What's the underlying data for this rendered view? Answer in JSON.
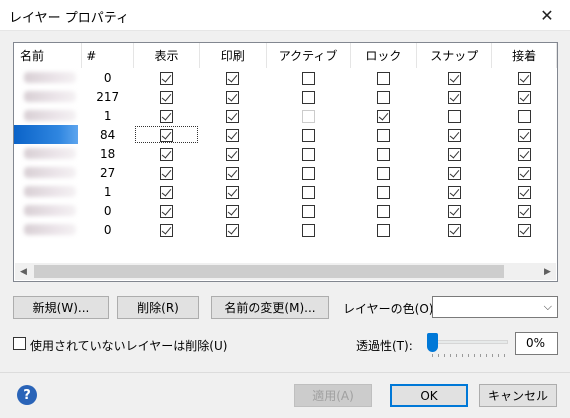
{
  "window": {
    "title": "レイヤー プロパティ"
  },
  "table": {
    "columns": [
      {
        "key": "name",
        "label": "名前",
        "width": 68
      },
      {
        "key": "count",
        "label": "#",
        "width": 52
      },
      {
        "key": "visible",
        "label": "表示",
        "width": 66
      },
      {
        "key": "print",
        "label": "印刷",
        "width": 67
      },
      {
        "key": "active",
        "label": "アクティブ",
        "width": 84
      },
      {
        "key": "lock",
        "label": "ロック",
        "width": 67
      },
      {
        "key": "snap",
        "label": "スナップ",
        "width": 75
      },
      {
        "key": "glue",
        "label": "接着",
        "width": 65
      }
    ],
    "rows": [
      {
        "count": "0",
        "visible": true,
        "print": true,
        "active": false,
        "lock": false,
        "snap": true,
        "glue": true
      },
      {
        "count": "217",
        "visible": true,
        "print": true,
        "active": false,
        "lock": false,
        "snap": true,
        "glue": true
      },
      {
        "count": "1",
        "visible": true,
        "print": true,
        "active": false,
        "active_disabled": true,
        "lock": true,
        "snap": false,
        "glue": false
      },
      {
        "count": "84",
        "visible": true,
        "print": true,
        "active": false,
        "lock": false,
        "snap": true,
        "glue": true,
        "selected": true,
        "focus": true
      },
      {
        "count": "18",
        "visible": true,
        "print": true,
        "active": false,
        "lock": false,
        "snap": true,
        "glue": true
      },
      {
        "count": "27",
        "visible": true,
        "print": true,
        "active": false,
        "lock": false,
        "snap": true,
        "glue": true
      },
      {
        "count": "1",
        "visible": true,
        "print": true,
        "active": false,
        "lock": false,
        "snap": true,
        "glue": true
      },
      {
        "count": "0",
        "visible": true,
        "print": true,
        "active": false,
        "lock": false,
        "snap": true,
        "glue": true
      },
      {
        "count": "0",
        "visible": true,
        "print": true,
        "active": false,
        "lock": false,
        "snap": true,
        "glue": true
      }
    ]
  },
  "buttons": {
    "new": "新規(W)...",
    "delete": "削除(R)",
    "rename": "名前の変更(M)...",
    "apply": "適用(A)",
    "ok": "OK",
    "cancel": "キャンセル"
  },
  "layer_color": {
    "label": "レイヤーの色(O):",
    "value": ""
  },
  "remove_unused": {
    "label": "使用されていないレイヤーは削除(U)",
    "checked": false
  },
  "transparency": {
    "label": "透過性(T):",
    "value": "0%",
    "level": 0
  },
  "icons": {
    "help": "?",
    "close": "✕",
    "dropdown": "⌵"
  }
}
